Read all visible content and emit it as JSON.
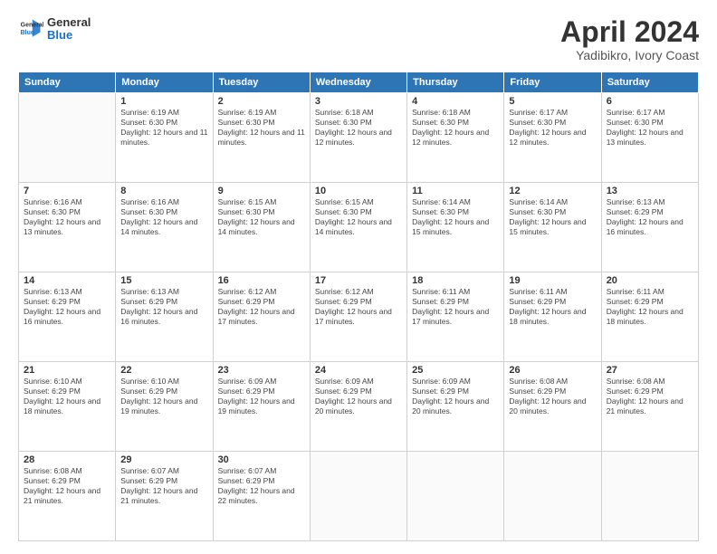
{
  "header": {
    "logo": {
      "line1": "General",
      "line2": "Blue"
    },
    "title": "April 2024",
    "location": "Yadibikro, Ivory Coast"
  },
  "weekdays": [
    "Sunday",
    "Monday",
    "Tuesday",
    "Wednesday",
    "Thursday",
    "Friday",
    "Saturday"
  ],
  "weeks": [
    [
      {
        "day": "",
        "sunrise": "",
        "sunset": "",
        "daylight": ""
      },
      {
        "day": "1",
        "sunrise": "Sunrise: 6:19 AM",
        "sunset": "Sunset: 6:30 PM",
        "daylight": "Daylight: 12 hours and 11 minutes."
      },
      {
        "day": "2",
        "sunrise": "Sunrise: 6:19 AM",
        "sunset": "Sunset: 6:30 PM",
        "daylight": "Daylight: 12 hours and 11 minutes."
      },
      {
        "day": "3",
        "sunrise": "Sunrise: 6:18 AM",
        "sunset": "Sunset: 6:30 PM",
        "daylight": "Daylight: 12 hours and 12 minutes."
      },
      {
        "day": "4",
        "sunrise": "Sunrise: 6:18 AM",
        "sunset": "Sunset: 6:30 PM",
        "daylight": "Daylight: 12 hours and 12 minutes."
      },
      {
        "day": "5",
        "sunrise": "Sunrise: 6:17 AM",
        "sunset": "Sunset: 6:30 PM",
        "daylight": "Daylight: 12 hours and 12 minutes."
      },
      {
        "day": "6",
        "sunrise": "Sunrise: 6:17 AM",
        "sunset": "Sunset: 6:30 PM",
        "daylight": "Daylight: 12 hours and 13 minutes."
      }
    ],
    [
      {
        "day": "7",
        "sunrise": "Sunrise: 6:16 AM",
        "sunset": "Sunset: 6:30 PM",
        "daylight": "Daylight: 12 hours and 13 minutes."
      },
      {
        "day": "8",
        "sunrise": "Sunrise: 6:16 AM",
        "sunset": "Sunset: 6:30 PM",
        "daylight": "Daylight: 12 hours and 14 minutes."
      },
      {
        "day": "9",
        "sunrise": "Sunrise: 6:15 AM",
        "sunset": "Sunset: 6:30 PM",
        "daylight": "Daylight: 12 hours and 14 minutes."
      },
      {
        "day": "10",
        "sunrise": "Sunrise: 6:15 AM",
        "sunset": "Sunset: 6:30 PM",
        "daylight": "Daylight: 12 hours and 14 minutes."
      },
      {
        "day": "11",
        "sunrise": "Sunrise: 6:14 AM",
        "sunset": "Sunset: 6:30 PM",
        "daylight": "Daylight: 12 hours and 15 minutes."
      },
      {
        "day": "12",
        "sunrise": "Sunrise: 6:14 AM",
        "sunset": "Sunset: 6:30 PM",
        "daylight": "Daylight: 12 hours and 15 minutes."
      },
      {
        "day": "13",
        "sunrise": "Sunrise: 6:13 AM",
        "sunset": "Sunset: 6:29 PM",
        "daylight": "Daylight: 12 hours and 16 minutes."
      }
    ],
    [
      {
        "day": "14",
        "sunrise": "Sunrise: 6:13 AM",
        "sunset": "Sunset: 6:29 PM",
        "daylight": "Daylight: 12 hours and 16 minutes."
      },
      {
        "day": "15",
        "sunrise": "Sunrise: 6:13 AM",
        "sunset": "Sunset: 6:29 PM",
        "daylight": "Daylight: 12 hours and 16 minutes."
      },
      {
        "day": "16",
        "sunrise": "Sunrise: 6:12 AM",
        "sunset": "Sunset: 6:29 PM",
        "daylight": "Daylight: 12 hours and 17 minutes."
      },
      {
        "day": "17",
        "sunrise": "Sunrise: 6:12 AM",
        "sunset": "Sunset: 6:29 PM",
        "daylight": "Daylight: 12 hours and 17 minutes."
      },
      {
        "day": "18",
        "sunrise": "Sunrise: 6:11 AM",
        "sunset": "Sunset: 6:29 PM",
        "daylight": "Daylight: 12 hours and 17 minutes."
      },
      {
        "day": "19",
        "sunrise": "Sunrise: 6:11 AM",
        "sunset": "Sunset: 6:29 PM",
        "daylight": "Daylight: 12 hours and 18 minutes."
      },
      {
        "day": "20",
        "sunrise": "Sunrise: 6:11 AM",
        "sunset": "Sunset: 6:29 PM",
        "daylight": "Daylight: 12 hours and 18 minutes."
      }
    ],
    [
      {
        "day": "21",
        "sunrise": "Sunrise: 6:10 AM",
        "sunset": "Sunset: 6:29 PM",
        "daylight": "Daylight: 12 hours and 18 minutes."
      },
      {
        "day": "22",
        "sunrise": "Sunrise: 6:10 AM",
        "sunset": "Sunset: 6:29 PM",
        "daylight": "Daylight: 12 hours and 19 minutes."
      },
      {
        "day": "23",
        "sunrise": "Sunrise: 6:09 AM",
        "sunset": "Sunset: 6:29 PM",
        "daylight": "Daylight: 12 hours and 19 minutes."
      },
      {
        "day": "24",
        "sunrise": "Sunrise: 6:09 AM",
        "sunset": "Sunset: 6:29 PM",
        "daylight": "Daylight: 12 hours and 20 minutes."
      },
      {
        "day": "25",
        "sunrise": "Sunrise: 6:09 AM",
        "sunset": "Sunset: 6:29 PM",
        "daylight": "Daylight: 12 hours and 20 minutes."
      },
      {
        "day": "26",
        "sunrise": "Sunrise: 6:08 AM",
        "sunset": "Sunset: 6:29 PM",
        "daylight": "Daylight: 12 hours and 20 minutes."
      },
      {
        "day": "27",
        "sunrise": "Sunrise: 6:08 AM",
        "sunset": "Sunset: 6:29 PM",
        "daylight": "Daylight: 12 hours and 21 minutes."
      }
    ],
    [
      {
        "day": "28",
        "sunrise": "Sunrise: 6:08 AM",
        "sunset": "Sunset: 6:29 PM",
        "daylight": "Daylight: 12 hours and 21 minutes."
      },
      {
        "day": "29",
        "sunrise": "Sunrise: 6:07 AM",
        "sunset": "Sunset: 6:29 PM",
        "daylight": "Daylight: 12 hours and 21 minutes."
      },
      {
        "day": "30",
        "sunrise": "Sunrise: 6:07 AM",
        "sunset": "Sunset: 6:29 PM",
        "daylight": "Daylight: 12 hours and 22 minutes."
      },
      {
        "day": "",
        "sunrise": "",
        "sunset": "",
        "daylight": ""
      },
      {
        "day": "",
        "sunrise": "",
        "sunset": "",
        "daylight": ""
      },
      {
        "day": "",
        "sunrise": "",
        "sunset": "",
        "daylight": ""
      },
      {
        "day": "",
        "sunrise": "",
        "sunset": "",
        "daylight": ""
      }
    ]
  ]
}
